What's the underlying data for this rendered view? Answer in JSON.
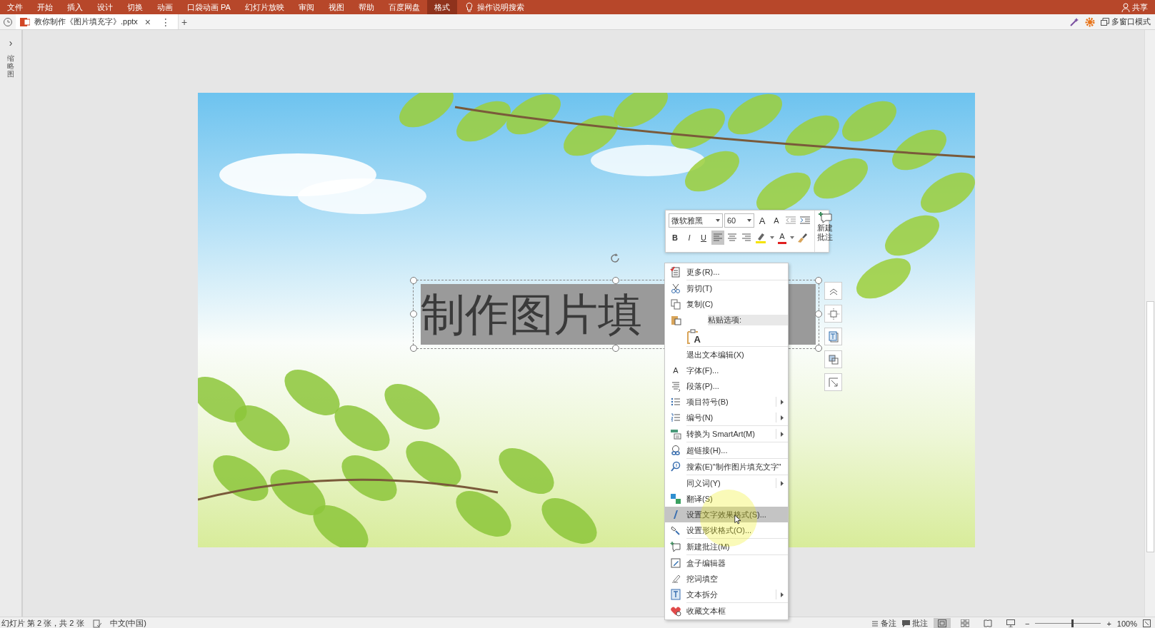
{
  "ribbon_tabs": [
    {
      "label": "文件",
      "selected": false
    },
    {
      "label": "开始",
      "selected": false
    },
    {
      "label": "插入",
      "selected": false
    },
    {
      "label": "设计",
      "selected": false
    },
    {
      "label": "切换",
      "selected": false
    },
    {
      "label": "动画",
      "selected": false
    },
    {
      "label": "口袋动画 PA",
      "selected": false
    },
    {
      "label": "幻灯片放映",
      "selected": false
    },
    {
      "label": "审阅",
      "selected": false
    },
    {
      "label": "视图",
      "selected": false
    },
    {
      "label": "帮助",
      "selected": false
    },
    {
      "label": "百度网盘",
      "selected": false
    },
    {
      "label": "格式",
      "selected": true
    }
  ],
  "tell_me": "操作说明搜索",
  "share": "共享",
  "document_tab": {
    "title": "教你制作《图片填充字》.pptx",
    "close": "×",
    "more": "⋮"
  },
  "new_tab": "+",
  "multi_window": "多窗口模式",
  "thumbnail_pane": {
    "expand": "›",
    "label": "缩略图"
  },
  "slide": {
    "text_box": "制作图片填"
  },
  "mini_toolbar": {
    "font": "微软雅黑",
    "size": "60",
    "grow": "A",
    "shrink": "A",
    "bold": "B",
    "italic": "I",
    "underline": "U",
    "align_buttons": [
      {
        "selected": true
      },
      {
        "selected": false
      },
      {
        "selected": false
      }
    ],
    "font_color": "A",
    "new_comment": "新建批注"
  },
  "context_menu": [
    {
      "kind": "item",
      "label": "更多(R)...",
      "submenu": false,
      "selected": false
    },
    {
      "kind": "separator"
    },
    {
      "kind": "item",
      "label": "剪切(T)",
      "submenu": false,
      "selected": false
    },
    {
      "kind": "item",
      "label": "复制(C)",
      "submenu": false,
      "selected": false
    },
    {
      "kind": "header",
      "label": "粘贴选项:"
    },
    {
      "kind": "paste",
      "label": "A"
    },
    {
      "kind": "separator"
    },
    {
      "kind": "item",
      "label": "退出文本编辑(X)",
      "submenu": false,
      "selected": false
    },
    {
      "kind": "item",
      "label": "字体(F)...",
      "glyph": "A",
      "submenu": false,
      "selected": false
    },
    {
      "kind": "item",
      "label": "段落(P)...",
      "submenu": false,
      "selected": false
    },
    {
      "kind": "item",
      "label": "项目符号(B)",
      "submenu": true,
      "selected": false
    },
    {
      "kind": "item",
      "label": "编号(N)",
      "submenu": true,
      "selected": false
    },
    {
      "kind": "separator"
    },
    {
      "kind": "item",
      "label": "转换为 SmartArt(M)",
      "submenu": true,
      "selected": false
    },
    {
      "kind": "separator"
    },
    {
      "kind": "item",
      "label": "超链接(H)...",
      "submenu": false,
      "selected": false
    },
    {
      "kind": "separator"
    },
    {
      "kind": "item",
      "label": "搜索(E)\"制作图片填充文字\"",
      "submenu": false,
      "selected": false
    },
    {
      "kind": "separator"
    },
    {
      "kind": "item",
      "label": "同义词(Y)",
      "submenu": true,
      "selected": false
    },
    {
      "kind": "item",
      "label": "翻译(S)",
      "submenu": false,
      "selected": false
    },
    {
      "kind": "item",
      "label": "设置文字效果格式(S)...",
      "submenu": false,
      "selected": true
    },
    {
      "kind": "item",
      "label": "设置形状格式(O)...",
      "submenu": false,
      "selected": false
    },
    {
      "kind": "separator"
    },
    {
      "kind": "item",
      "label": "新建批注(M)",
      "submenu": false,
      "selected": false
    },
    {
      "kind": "separator"
    },
    {
      "kind": "item",
      "label": "盒子编辑器",
      "submenu": false,
      "selected": false
    },
    {
      "kind": "item",
      "label": "挖词填空",
      "submenu": false,
      "selected": false
    },
    {
      "kind": "item",
      "label": "文本拆分",
      "submenu": true,
      "selected": false
    },
    {
      "kind": "separator"
    },
    {
      "kind": "item",
      "label": "收藏文本框",
      "submenu": false,
      "selected": false
    }
  ],
  "status_bar": {
    "slide_info": "幻灯片 第 2 张，共 2 张",
    "language": "中文(中国)",
    "notes": "备注",
    "comments": "批注",
    "views": [
      {
        "selected": true
      },
      {
        "selected": false
      },
      {
        "selected": false
      },
      {
        "selected": false
      }
    ],
    "zoom_out": "−",
    "zoom_in": "+",
    "zoom": {
      "level": 0.55,
      "reading": "100%"
    }
  }
}
